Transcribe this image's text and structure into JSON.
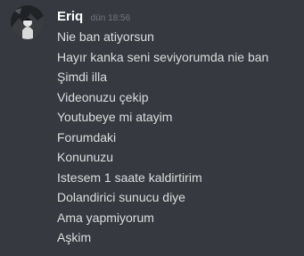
{
  "message": {
    "author": "Eriq",
    "timestamp": "dün 18:56",
    "lines": [
      "Nie ban atiyorsun",
      "Hayır kanka seni seviyorumda nie ban",
      "Şimdi illa",
      "Videonuzu çekip",
      "Youtubeye mi atayim",
      "Forumdaki",
      "Konunuzu",
      "Istesem 1 saate kaldirtirim",
      "Dolandirici sunucu diye",
      "Ama yapmiyorum",
      "Aşkim"
    ]
  },
  "colors": {
    "background": "#36393f",
    "username": "#ffffff",
    "timestamp": "#72767d",
    "message_text": "#dcddde"
  },
  "icons": {
    "avatar": "user-avatar-image"
  }
}
